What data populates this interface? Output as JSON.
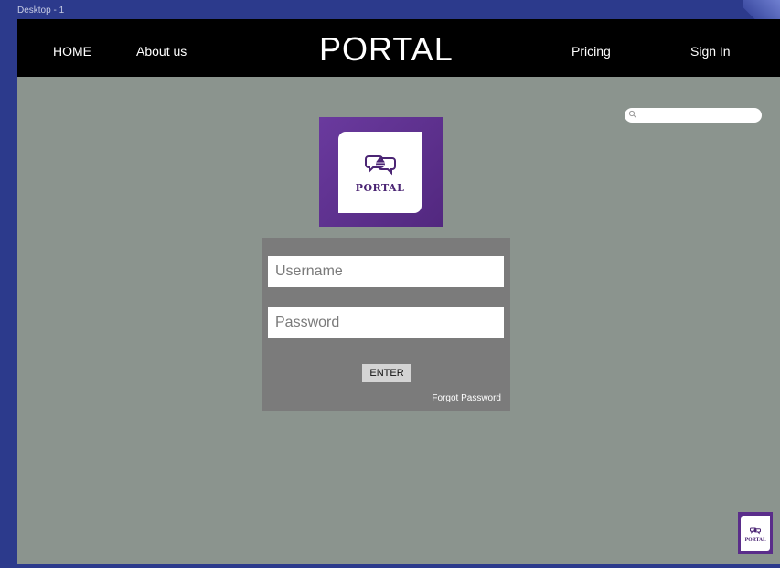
{
  "artboard": {
    "label": "Desktop - 1"
  },
  "nav": {
    "home": "HOME",
    "about": "About us",
    "title": "PORTAL",
    "pricing": "Pricing",
    "signin": "Sign In"
  },
  "search": {
    "placeholder": ""
  },
  "logo": {
    "text": "PORTAL",
    "icon": "speech-bubbles-icon",
    "brand_color": "#5a2d8a"
  },
  "login": {
    "username_placeholder": "Username",
    "password_placeholder": "Password",
    "enter_label": "ENTER",
    "forgot_label": "Forgot Password"
  },
  "small_logo": {
    "text": "PORTAL"
  },
  "colors": {
    "artboard_bg": "#8b948e",
    "nav_bg": "#000000",
    "panel_bg": "#7b7b7b",
    "desktop_bg": "#2c3a8c"
  }
}
